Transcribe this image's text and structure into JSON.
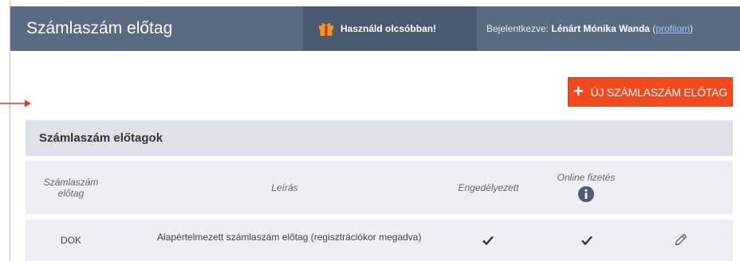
{
  "header": {
    "title": "Számlaszám előtag",
    "promo_label": "Használd olcsóbban!",
    "login_prefix": "Bejelentkezve: ",
    "login_name": "Lénárt Mónika Wanda",
    "profile_link": "profilom"
  },
  "toolbar": {
    "new_button_label": "ÚJ SZÁMLASZÁM ELŐTAG"
  },
  "panel": {
    "title": "Számlaszám előtagok"
  },
  "table": {
    "columns": {
      "prefix": "Számlaszám előtag",
      "description": "Leírás",
      "enabled": "Engedélyezett",
      "online_payment": "Online fizetés"
    },
    "rows": [
      {
        "prefix": "DOK",
        "description": "Alapértelmezett számlaszám előtag (regisztrációkor megadva)",
        "enabled": true,
        "online_payment": true
      }
    ]
  },
  "colors": {
    "header_bg": "#5a6a82",
    "promo_bg": "#4b5a71",
    "accent": "#f24a1d",
    "panel_head_bg": "#dde2ea",
    "table_bg": "#eceff3",
    "arrow": "#e03a1e"
  },
  "icons": {
    "promo": "gift-icon",
    "info": "info-icon",
    "check": "check-icon",
    "edit": "pencil-icon",
    "pointer": "arrow-right-icon",
    "add": "plus-icon"
  }
}
